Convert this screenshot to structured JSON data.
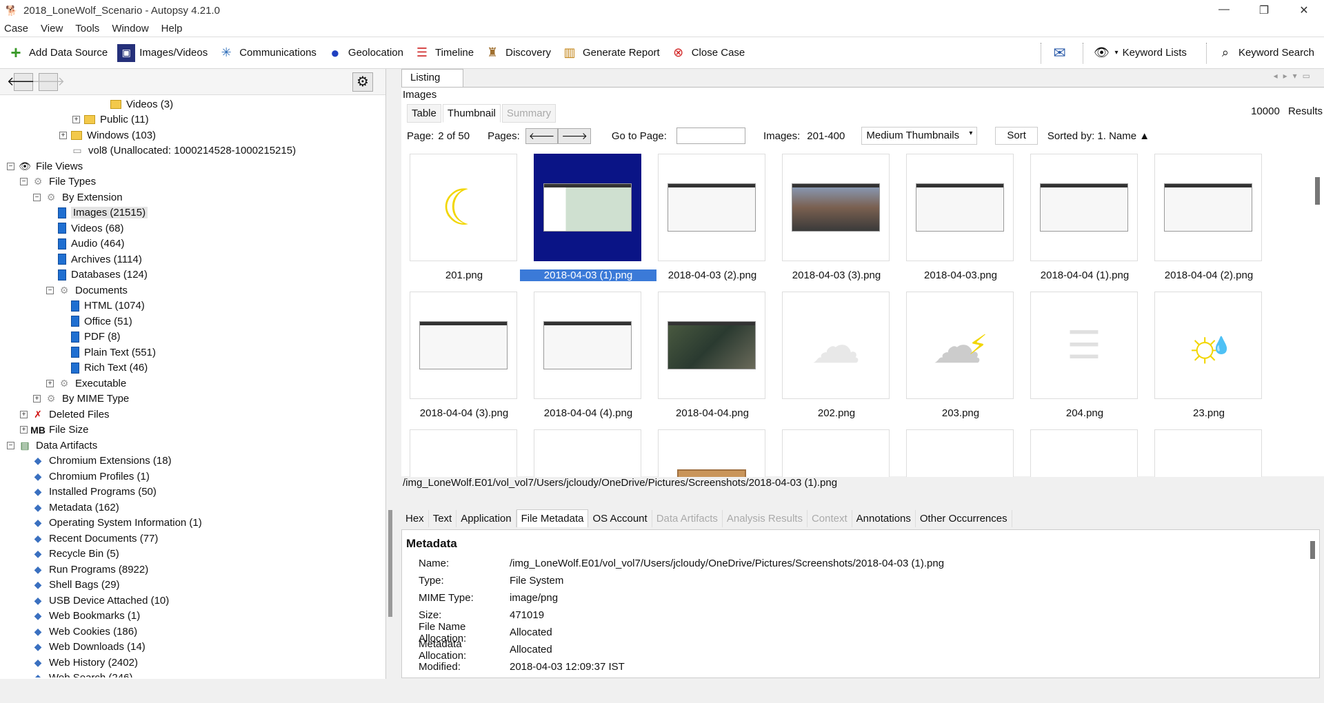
{
  "window": {
    "title": "2018_LoneWolf_Scenario - Autopsy 4.21.0"
  },
  "menu": [
    "Case",
    "View",
    "Tools",
    "Window",
    "Help"
  ],
  "toolbar": {
    "add_data_source": "Add Data Source",
    "images_videos": "Images/Videos",
    "communications": "Communications",
    "geolocation": "Geolocation",
    "timeline": "Timeline",
    "discovery": "Discovery",
    "generate_report": "Generate Report",
    "close_case": "Close Case",
    "keyword_lists": "Keyword Lists",
    "keyword_search": "Keyword Search"
  },
  "tree": [
    {
      "label": "Videos (3)",
      "indent": 7
    },
    {
      "label": "Public (11)",
      "indent": 5
    },
    {
      "label": "Windows (103)",
      "indent": 4
    },
    {
      "label": "vol8 (Unallocated: 1000214528-1000215215)",
      "indent": 4
    },
    {
      "label": "File Views",
      "indent": 0
    },
    {
      "label": "File Types",
      "indent": 1
    },
    {
      "label": "By Extension",
      "indent": 2
    },
    {
      "label": "Images (21515)",
      "indent": 3
    },
    {
      "label": "Videos (68)",
      "indent": 3
    },
    {
      "label": "Audio (464)",
      "indent": 3
    },
    {
      "label": "Archives (1114)",
      "indent": 3
    },
    {
      "label": "Databases (124)",
      "indent": 3
    },
    {
      "label": "Documents",
      "indent": 3
    },
    {
      "label": "HTML (1074)",
      "indent": 4
    },
    {
      "label": "Office (51)",
      "indent": 4
    },
    {
      "label": "PDF (8)",
      "indent": 4
    },
    {
      "label": "Plain Text (551)",
      "indent": 4
    },
    {
      "label": "Rich Text (46)",
      "indent": 4
    },
    {
      "label": "Executable",
      "indent": 3
    },
    {
      "label": "By MIME Type",
      "indent": 2
    },
    {
      "label": "Deleted Files",
      "indent": 1
    },
    {
      "label": "File Size",
      "indent": 1
    },
    {
      "label": "Data Artifacts",
      "indent": 0
    },
    {
      "label": "Chromium Extensions (18)",
      "indent": 1
    },
    {
      "label": "Chromium Profiles (1)",
      "indent": 1
    },
    {
      "label": "Installed Programs (50)",
      "indent": 1
    },
    {
      "label": "Metadata (162)",
      "indent": 1
    },
    {
      "label": "Operating System Information (1)",
      "indent": 1
    },
    {
      "label": "Recent Documents (77)",
      "indent": 1
    },
    {
      "label": "Recycle Bin (5)",
      "indent": 1
    },
    {
      "label": "Run Programs (8922)",
      "indent": 1
    },
    {
      "label": "Shell Bags (29)",
      "indent": 1
    },
    {
      "label": "USB Device Attached (10)",
      "indent": 1
    },
    {
      "label": "Web Bookmarks (1)",
      "indent": 1
    },
    {
      "label": "Web Cookies (186)",
      "indent": 1
    },
    {
      "label": "Web Downloads (14)",
      "indent": 1
    },
    {
      "label": "Web History (2402)",
      "indent": 1
    },
    {
      "label": "Web Search (246)",
      "indent": 1
    }
  ],
  "file_size_badge": "MB",
  "listing": {
    "tab": "Listing",
    "section": "Images",
    "results_count": "10000",
    "results_label": "Results",
    "view_tabs": [
      "Table",
      "Thumbnail",
      "Summary"
    ],
    "page_label": "Page:",
    "page_value": "2 of 50",
    "pages_label": "Pages:",
    "goto_label": "Go to Page:",
    "images_label": "Images:",
    "images_range": "201-400",
    "thumb_size": "Medium Thumbnails",
    "sort_btn": "Sort",
    "sorted_by": "Sorted by: 1. Name ▲"
  },
  "thumbnails": [
    "201.png",
    "2018-04-03 (1).png",
    "2018-04-03 (2).png",
    "2018-04-03 (3).png",
    "2018-04-03.png",
    "2018-04-04 (1).png",
    "2018-04-04 (2).png",
    "2018-04-04 (3).png",
    "2018-04-04 (4).png",
    "2018-04-04.png",
    "202.png",
    "203.png",
    "204.png",
    "23.png",
    "",
    "",
    "",
    "",
    "",
    "",
    ""
  ],
  "selected_path": "/img_LoneWolf.E01/vol_vol7/Users/jcloudy/OneDrive/Pictures/Screenshots/2018-04-03 (1).png",
  "lower_tabs": [
    "Hex",
    "Text",
    "Application",
    "File Metadata",
    "OS Account",
    "Data Artifacts",
    "Analysis Results",
    "Context",
    "Annotations",
    "Other Occurrences"
  ],
  "metadata": {
    "heading": "Metadata",
    "rows": [
      {
        "k": "Name:",
        "v": "/img_LoneWolf.E01/vol_vol7/Users/jcloudy/OneDrive/Pictures/Screenshots/2018-04-03 (1).png"
      },
      {
        "k": "Type:",
        "v": "File System"
      },
      {
        "k": "MIME Type:",
        "v": "image/png"
      },
      {
        "k": "Size:",
        "v": "471019"
      },
      {
        "k": "File Name Allocation:",
        "v": "Allocated"
      },
      {
        "k": "Metadata Allocation:",
        "v": "Allocated"
      },
      {
        "k": "Modified:",
        "v": "2018-04-03 12:09:37 IST"
      }
    ]
  }
}
